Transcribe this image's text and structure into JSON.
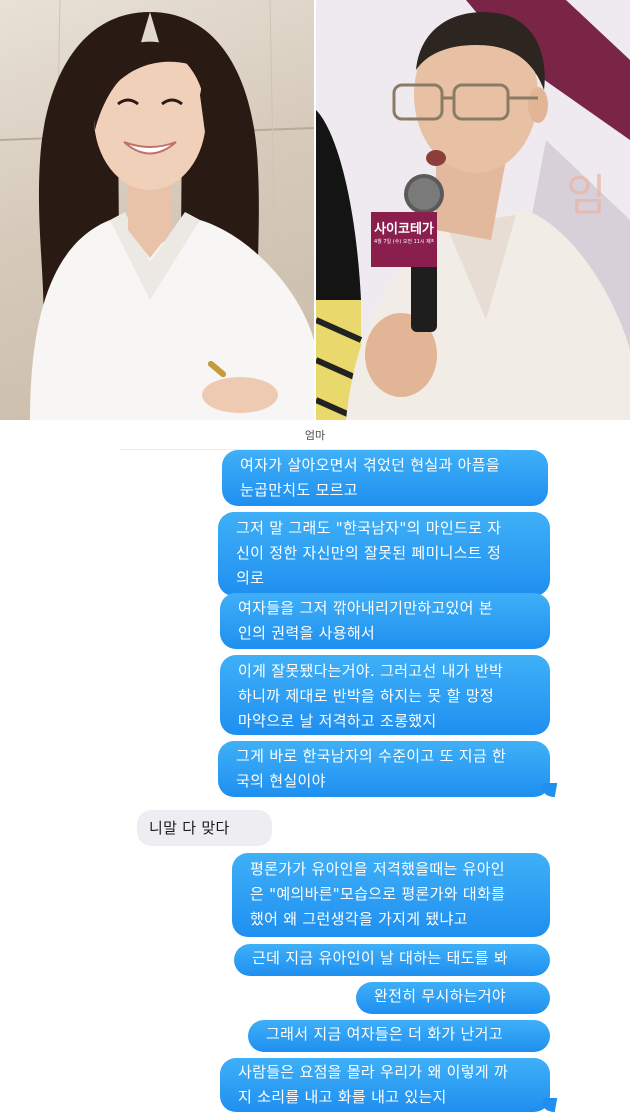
{
  "photos": {
    "microphone_sign": "사이코테가",
    "microphone_sign_sub": "4월 7일 (수) 오전 11시 제작발표회"
  },
  "chat": {
    "contact_name": "엄마",
    "messages": [
      {
        "from": "me",
        "lines": [
          "여자가 살아오면서 겪었던 현실과 아픔을",
          "눈곱만치도 모르고"
        ]
      },
      {
        "from": "me",
        "lines": [
          "그저 말 그래도 \"한국남자\"의 마인드로 자",
          "신이 정한 자신만의 잘못된 페미니스트 정",
          "의로"
        ]
      },
      {
        "from": "me",
        "lines": [
          "여자들을 그저 깎아내리기만하고있어 본",
          "인의 권력을 사용해서"
        ]
      },
      {
        "from": "me",
        "lines": [
          "이게 잘못됐다는거야. 그러고선 내가 반박",
          "하니까 제대로 반박을 하지는 못 할 망정",
          "마약으로 날 저격하고 조롱했지"
        ]
      },
      {
        "from": "me",
        "lines": [
          "그게 바로 한국남자의 수준이고 또 지금 한",
          "국의 현실이야"
        ]
      },
      {
        "from": "other",
        "lines": [
          "니말 다 맞다"
        ]
      },
      {
        "from": "me",
        "lines": [
          "평론가가 유아인을 저격했을때는 유아인",
          "은 \"예의바른\"모습으로 평론가와 대화를",
          "했어 왜 그런생각을 가지게 됐냐고"
        ]
      },
      {
        "from": "me",
        "lines": [
          "근데 지금 유아인이 날 대하는 태도를 봐"
        ]
      },
      {
        "from": "me",
        "lines": [
          "완전히 무시하는거야"
        ]
      },
      {
        "from": "me",
        "lines": [
          "그래서 지금 여자들은 더 화가 난거고"
        ]
      },
      {
        "from": "me",
        "lines": [
          "사람들은 요점을 몰라 우리가 왜 이렇게 까",
          "지 소리를 내고 화를 내고 있는지"
        ]
      }
    ]
  },
  "colors": {
    "outgoing_bubble": "#1f8ff0",
    "incoming_bubble": "#eeeef2"
  }
}
